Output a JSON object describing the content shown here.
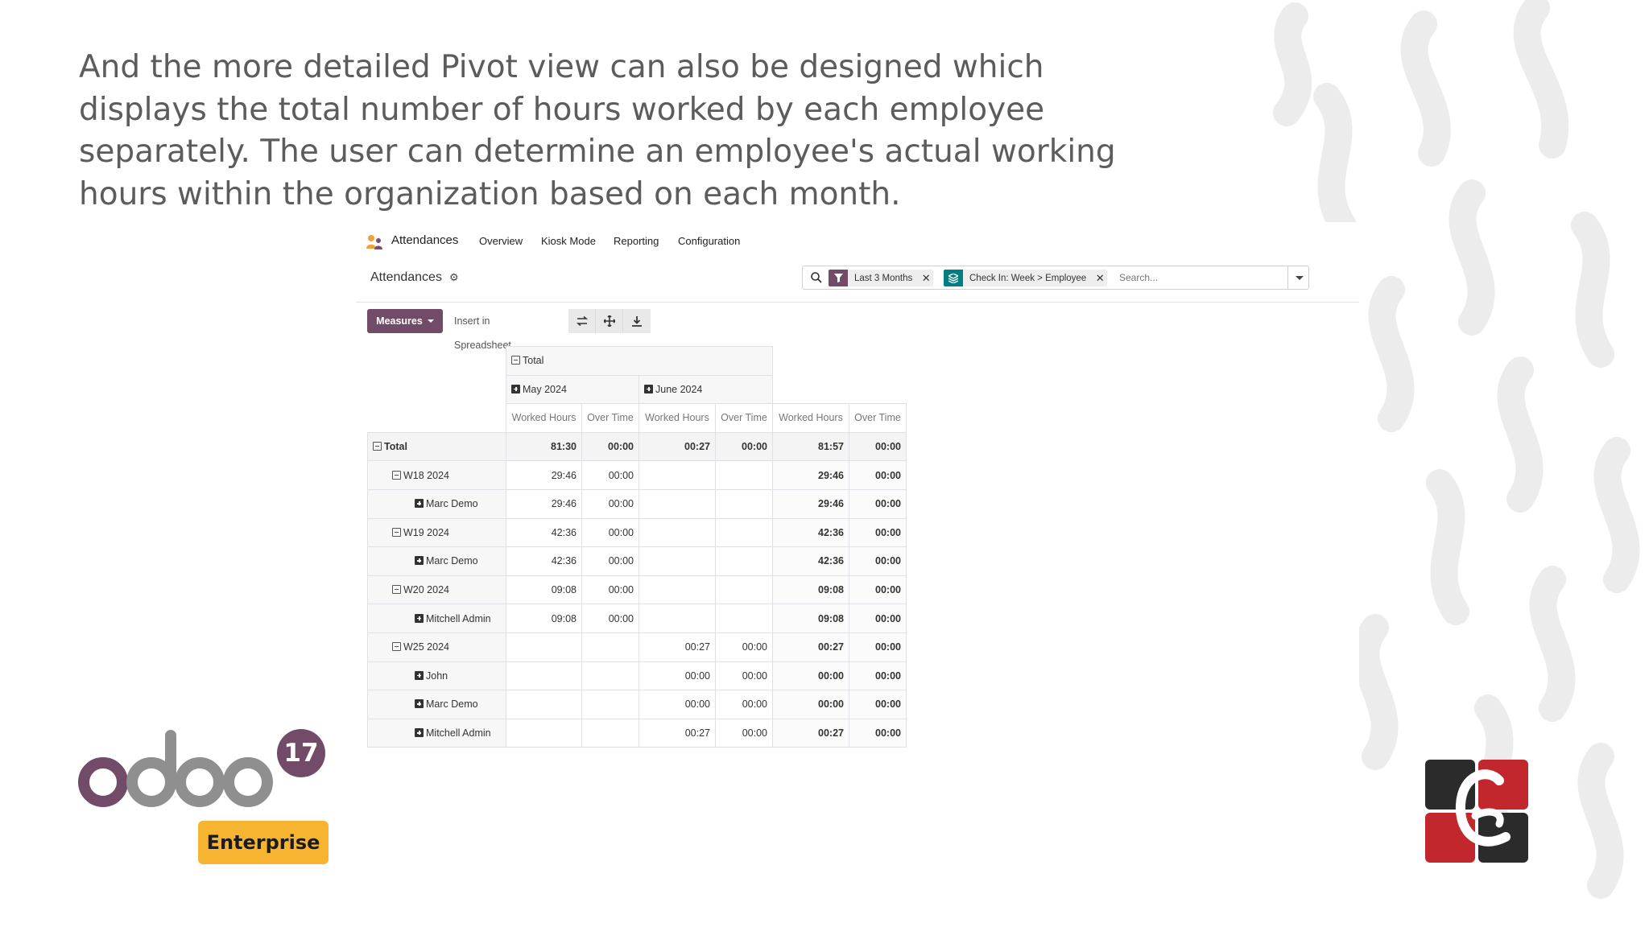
{
  "intro": {
    "text": "And the more detailed Pivot view can also be designed which displays the total number of hours worked by each employee separately. The user can determine an employee's actual working hours within the organization based on each month."
  },
  "navbar": {
    "app_name": "Attendances",
    "items": [
      "Overview",
      "Kiosk Mode",
      "Reporting",
      "Configuration"
    ]
  },
  "control_panel": {
    "title": "Attendances",
    "facets": [
      {
        "icon": "filter-icon",
        "label": "Last 3 Months"
      },
      {
        "icon": "group-by-icon",
        "label": "Check In: Week > Employee"
      }
    ],
    "search_placeholder": "Search..."
  },
  "toolbar": {
    "measures_label": "Measures",
    "insert_label": "Insert in Spreadsheet",
    "icons": [
      "flip-axis-icon",
      "expand-all-icon",
      "download-icon"
    ]
  },
  "pivot": {
    "col_total": "Total",
    "col_groups": [
      "May 2024",
      "June 2024"
    ],
    "measures": [
      "Worked Hours",
      "Over Time",
      "Worked Hours",
      "Over Time",
      "Worked Hours",
      "Over Time"
    ],
    "rows": [
      {
        "label": "Total",
        "level": 0,
        "expand": "minus",
        "values": [
          "81:30",
          "00:00",
          "00:27",
          "00:00",
          "81:57",
          "00:00"
        ]
      },
      {
        "label": "W18 2024",
        "level": 1,
        "expand": "minus",
        "values": [
          "29:46",
          "00:00",
          "",
          "",
          "29:46",
          "00:00"
        ]
      },
      {
        "label": "Marc Demo",
        "level": 2,
        "expand": "plus",
        "values": [
          "29:46",
          "00:00",
          "",
          "",
          "29:46",
          "00:00"
        ]
      },
      {
        "label": "W19 2024",
        "level": 1,
        "expand": "minus",
        "values": [
          "42:36",
          "00:00",
          "",
          "",
          "42:36",
          "00:00"
        ]
      },
      {
        "label": "Marc Demo",
        "level": 2,
        "expand": "plus",
        "values": [
          "42:36",
          "00:00",
          "",
          "",
          "42:36",
          "00:00"
        ]
      },
      {
        "label": "W20 2024",
        "level": 1,
        "expand": "minus",
        "values": [
          "09:08",
          "00:00",
          "",
          "",
          "09:08",
          "00:00"
        ]
      },
      {
        "label": "Mitchell Admin",
        "level": 2,
        "expand": "plus",
        "values": [
          "09:08",
          "00:00",
          "",
          "",
          "09:08",
          "00:00"
        ]
      },
      {
        "label": "W25 2024",
        "level": 1,
        "expand": "minus",
        "values": [
          "",
          "",
          "00:27",
          "00:00",
          "00:27",
          "00:00"
        ]
      },
      {
        "label": "John",
        "level": 2,
        "expand": "plus",
        "values": [
          "",
          "",
          "00:00",
          "00:00",
          "00:00",
          "00:00"
        ]
      },
      {
        "label": "Marc Demo",
        "level": 2,
        "expand": "plus",
        "values": [
          "",
          "",
          "00:00",
          "00:00",
          "00:00",
          "00:00"
        ]
      },
      {
        "label": "Mitchell Admin",
        "level": 2,
        "expand": "plus",
        "values": [
          "",
          "",
          "00:27",
          "00:00",
          "00:27",
          "00:00"
        ]
      }
    ]
  },
  "branding": {
    "logo_text": "odoo",
    "version": "17",
    "edition": "Enterprise",
    "colors": {
      "odoo_purple": "#714b67",
      "odoo_gray": "#8f8f8f",
      "enterprise_yellow": "#f7b431",
      "partner_red": "#c1272d",
      "partner_dark": "#2b2b2b"
    }
  }
}
